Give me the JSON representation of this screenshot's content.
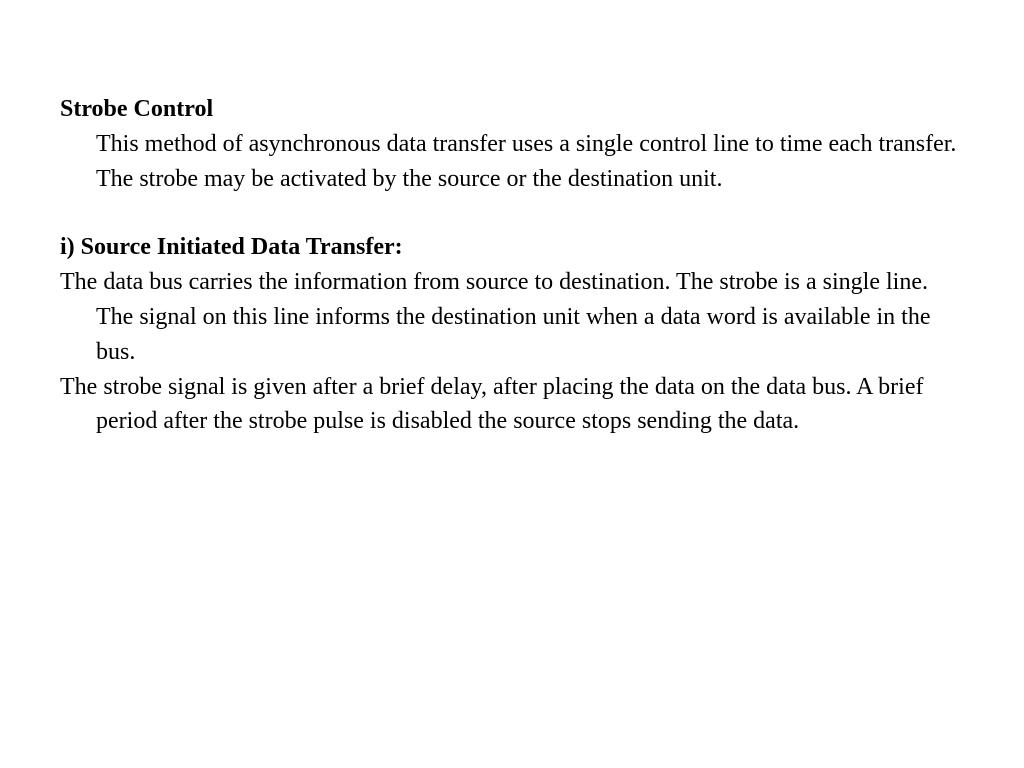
{
  "section1": {
    "title": "Strobe Control",
    "para1": "This method of asynchronous data transfer uses a single control line to time each transfer. The strobe may be activated by the source or the destination unit."
  },
  "section2": {
    "title": "i) Source Initiated Data Transfer:",
    "para1": "The data bus carries the information from source to destination. The strobe is a single line. The signal on this line informs the destination unit when a data word is available in the bus.",
    "para2": "The strobe signal is given after a brief delay, after placing the data on the data bus. A brief period after the strobe pulse is disabled the source stops sending the data."
  }
}
